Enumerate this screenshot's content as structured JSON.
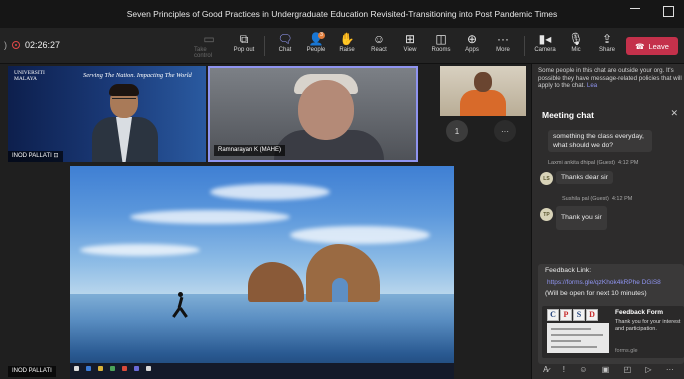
{
  "window": {
    "title": "Seven Principles of Good Practices in Undergraduate Education Revisited-Transitioning into Post Pandemic Times"
  },
  "toolbar": {
    "timer": "02:26:27",
    "buttons": [
      {
        "label": "Take control",
        "icon": "hand-pointer-icon"
      },
      {
        "label": "Pop out",
        "icon": "popout-icon"
      },
      {
        "label": "Chat",
        "icon": "chat-icon"
      },
      {
        "label": "People",
        "icon": "people-icon"
      },
      {
        "label": "Raise",
        "icon": "raise-hand-icon"
      },
      {
        "label": "React",
        "icon": "react-icon"
      },
      {
        "label": "View",
        "icon": "view-grid-icon"
      },
      {
        "label": "Rooms",
        "icon": "rooms-icon"
      },
      {
        "label": "Apps",
        "icon": "apps-icon"
      },
      {
        "label": "More",
        "icon": "more-icon"
      },
      {
        "label": "Camera",
        "icon": "camera-icon"
      },
      {
        "label": "Mic",
        "icon": "mic-icon"
      },
      {
        "label": "Share",
        "icon": "share-icon"
      }
    ],
    "leave_label": "Leave",
    "leave_color": "#c4314b"
  },
  "participants": {
    "tile1": {
      "name": "INOD PALLATI",
      "slide_logo": "UNIVERSITI MALAYA",
      "slide_tag": "Serving The Nation. Impacting The World"
    },
    "tile2": {
      "name": "Ramnarayan K (MAHE)"
    },
    "overflow_count": "1",
    "share_name": "INOD PALLATI"
  },
  "chat": {
    "notice": "Some people in this chat are outside your org. It's possible they have message-related policies that will apply to the chat.",
    "notice_link": "Lea",
    "title": "Meeting chat",
    "partial_msg": "something the class everyday, what should we do?",
    "messages": [
      {
        "sender": "Laxmi ankita dhipal (Guest)",
        "time": "4:12 PM",
        "initials": "LS",
        "text": "Thanks dear sir"
      },
      {
        "sender": "Sushila pal (Guest)",
        "time": "4:12 PM",
        "initials": "TP",
        "text": "Thank you sir"
      }
    ],
    "feedback": {
      "label": "Feedback Link:",
      "url": "https://forms.gle/qzKhok4kRPhe DGiS8",
      "note": "(Will be open for next 10 minutes)",
      "logo_letters": [
        "C",
        "P",
        "S",
        "D"
      ],
      "card_title": "Feedback Form",
      "card_desc": "Thank you for your interest and participation.",
      "card_domain": "forms.gle"
    }
  }
}
